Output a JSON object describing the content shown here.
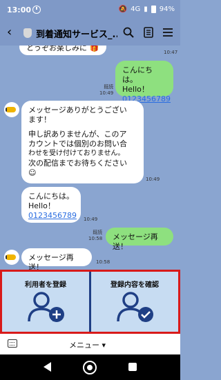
{
  "status": {
    "time": "13:00",
    "network": "4G",
    "battery": "94%"
  },
  "header": {
    "title": "到着通知サービス_..."
  },
  "messages": {
    "m0_text": "とうぞお楽しみに",
    "m0_time": "10:47",
    "m1_line1": "こんにちは。",
    "m1_line2": "Hello！",
    "m1_link": "0123456789",
    "m1_read": "既読",
    "m1_time": "10:49",
    "m2_line1": "メッセージありがとうござい",
    "m2_line2": "ます！",
    "m2_line3": "申し訳ありませんが、このア",
    "m2_line4": "カウントでは個別のお問い合",
    "m2_line5": "わせを受け付けておりません。",
    "m2_line6": "次の配信までお待ちください",
    "m2_time": "10:49",
    "m3_line1": "こんにちは。",
    "m3_line2": "Hello！",
    "m3_link": "0123456789",
    "m3_time": "10:49",
    "m4_read": "既読",
    "m4_time": "10:58",
    "m4_text": "メッセージ再送！",
    "m5_text": "メッセージ再送！",
    "m5_time": "10:58"
  },
  "richmenu": {
    "left_label": "利用者を登録",
    "right_label": "登録内容を確認",
    "accent": "#1f3f85",
    "background": "#c7dcf2"
  },
  "bottombar": {
    "menu_label": "メニュー ▾"
  }
}
